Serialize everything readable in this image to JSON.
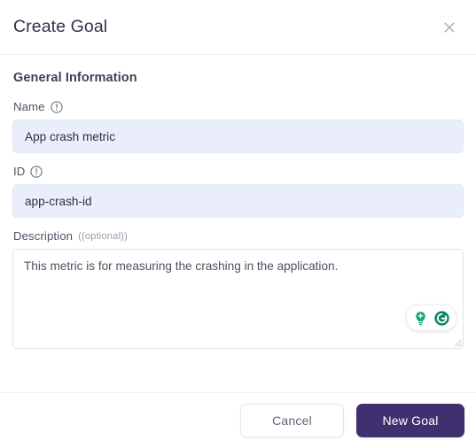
{
  "dialog": {
    "title": "Create Goal",
    "close_icon": "close-icon"
  },
  "section": {
    "heading": "General Information"
  },
  "fields": {
    "name": {
      "label": "Name",
      "info_icon": "info-circle-icon",
      "value": "App crash metric",
      "placeholder": ""
    },
    "id": {
      "label": "ID",
      "info_icon": "info-circle-icon",
      "value": "app-crash-id",
      "placeholder": ""
    },
    "description": {
      "label": "Description",
      "optional_tag": "((optional))",
      "value": "This metric is for measuring the crashing in the application.",
      "placeholder": ""
    }
  },
  "assistant": {
    "lightbulb_icon": "lightbulb-icon",
    "grammarly_icon": "grammarly-g-icon",
    "accent_color": "#15a47e",
    "dark_accent_color": "#0f8468"
  },
  "footer": {
    "cancel_label": "Cancel",
    "submit_label": "New Goal",
    "submit_color": "#40306f"
  },
  "theme": {
    "input_background": "#e9eefa",
    "divider": "#eceef2",
    "title_color": "#2f3545"
  }
}
